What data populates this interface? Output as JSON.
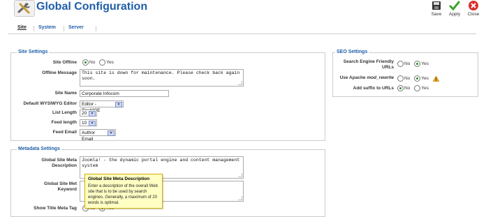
{
  "header": {
    "title": "Global Configuration",
    "buttons": {
      "save": "Save",
      "apply": "Apply",
      "close": "Close"
    }
  },
  "tabs": [
    "Site",
    "System",
    "Server"
  ],
  "site_settings": {
    "legend": "Site Settings",
    "site_offline": {
      "label": "Site Offline",
      "options": [
        "No",
        "Yes"
      ],
      "selected": "No"
    },
    "offline_message": {
      "label": "Offline Message",
      "value": "This site is down for maintenance. Please check back again soon."
    },
    "site_name": {
      "label": "Site Name",
      "value": "Corporate Infocom"
    },
    "editor": {
      "label": "Default WYSIWYG Editor",
      "value": "Editor - TinyMCE"
    },
    "list_length": {
      "label": "List Length",
      "value": "20"
    },
    "feed_length": {
      "label": "Feed length",
      "value": "10"
    },
    "feed_email": {
      "label": "Feed Email",
      "value": "Author Email"
    }
  },
  "metadata_settings": {
    "legend": "Metadata Settings",
    "meta_description": {
      "label_1": "Global Site Meta",
      "label_2": "Description",
      "value": "Joomla! - the dynamic portal engine and content management system"
    },
    "meta_keywords": {
      "label_1": "Global Site Met",
      "label_2": "Keyword"
    },
    "show_title": {
      "label": "Show Title Meta Tag",
      "options": [
        "No",
        "Yes"
      ],
      "selected": "Yes"
    }
  },
  "tooltip": {
    "title": "Global Site Meta Description",
    "body": "Enter a description of the overall Web site that is to be used by search engines. Generally, a maximum of 20 words is optimal."
  },
  "seo_settings": {
    "legend": "SEO Settings",
    "sef_urls": {
      "label_1": "Search Engine Friendly",
      "label_2": "URLs",
      "options": [
        "No",
        "Yes"
      ],
      "selected": "Yes"
    },
    "mod_rewrite": {
      "label_prefix": "Use Apache ",
      "label_em": "mod_rewrite",
      "options": [
        "No",
        "Yes"
      ],
      "selected": "Yes"
    },
    "suffix": {
      "label": "Add suffix to URLs",
      "options": [
        "No",
        "Yes"
      ],
      "selected": "No"
    }
  },
  "colors": {
    "accent": "#1f5ea8",
    "tooltip_bg": "#ffffc4",
    "warning": "#f2b01e"
  }
}
